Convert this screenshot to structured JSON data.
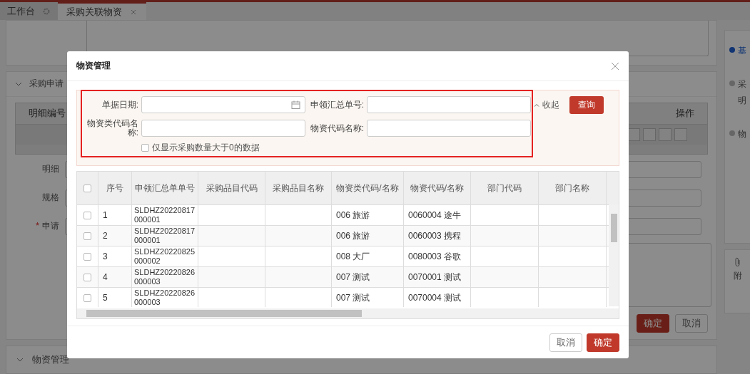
{
  "tabs": [
    {
      "label": "工作台",
      "selected": false
    },
    {
      "label": "采购关联物资",
      "selected": true
    }
  ],
  "background": {
    "section_1": "采购申请",
    "detail_table": {
      "columns": [
        "明细编号",
        "操作"
      ]
    },
    "fields": [
      {
        "label": "明细"
      },
      {
        "label": "规格"
      },
      {
        "marker": "*",
        "label": "申请"
      }
    ],
    "buttons": [
      {
        "label": "确定",
        "kind": "primary"
      },
      {
        "label": "取消",
        "kind": "plain"
      }
    ],
    "section_2": "物资管理",
    "nav": [
      {
        "label": "基",
        "selected": true
      },
      {
        "label": "采",
        "sub": "明",
        "selected": false
      },
      {
        "label": "物",
        "selected": false
      }
    ],
    "attachment": "附"
  },
  "dialog": {
    "title": "物资管理",
    "filters": [
      {
        "label": "单据日期:",
        "kind": "date"
      },
      {
        "label": "申领汇总单号:",
        "kind": "text"
      },
      {
        "label": "物资类代码名称:",
        "kind": "text"
      },
      {
        "label": "物资代码名称:",
        "kind": "text"
      }
    ],
    "only_positive": {
      "label": "仅显示采购数量大于0的数据",
      "checked": false
    },
    "collapse": "收起",
    "query_button": "查询",
    "table": {
      "all_checked": false,
      "columns": [
        "序号",
        "申领汇总单单号",
        "采购品目代码",
        "采购品目名称",
        "物资类代码/名称",
        "物资代码/名称",
        "部门代码",
        "部门名称"
      ],
      "rows": [
        {
          "selected": false,
          "cells": [
            "1",
            "SLDHZ20220817000001",
            "",
            "",
            "006 旅游",
            "0060004 途牛",
            "",
            ""
          ]
        },
        {
          "selected": false,
          "cells": [
            "2",
            "SLDHZ20220817000001",
            "",
            "",
            "006 旅游",
            "0060003 携程",
            "",
            ""
          ]
        },
        {
          "selected": false,
          "cells": [
            "3",
            "SLDHZ20220825000002",
            "",
            "",
            "008 大厂",
            "0080003 谷歌",
            "",
            ""
          ]
        },
        {
          "selected": false,
          "cells": [
            "4",
            "SLDHZ20220826000003",
            "",
            "",
            "007 测试",
            "0070001 测试",
            "",
            ""
          ]
        },
        {
          "selected": false,
          "cells": [
            "5",
            "SLDHZ20220826000003",
            "",
            "",
            "007 测试",
            "0070004 测试",
            "",
            ""
          ]
        }
      ]
    },
    "buttons": [
      {
        "label": "取消",
        "kind": "plain"
      },
      {
        "label": "确定",
        "kind": "primary"
      }
    ]
  }
}
